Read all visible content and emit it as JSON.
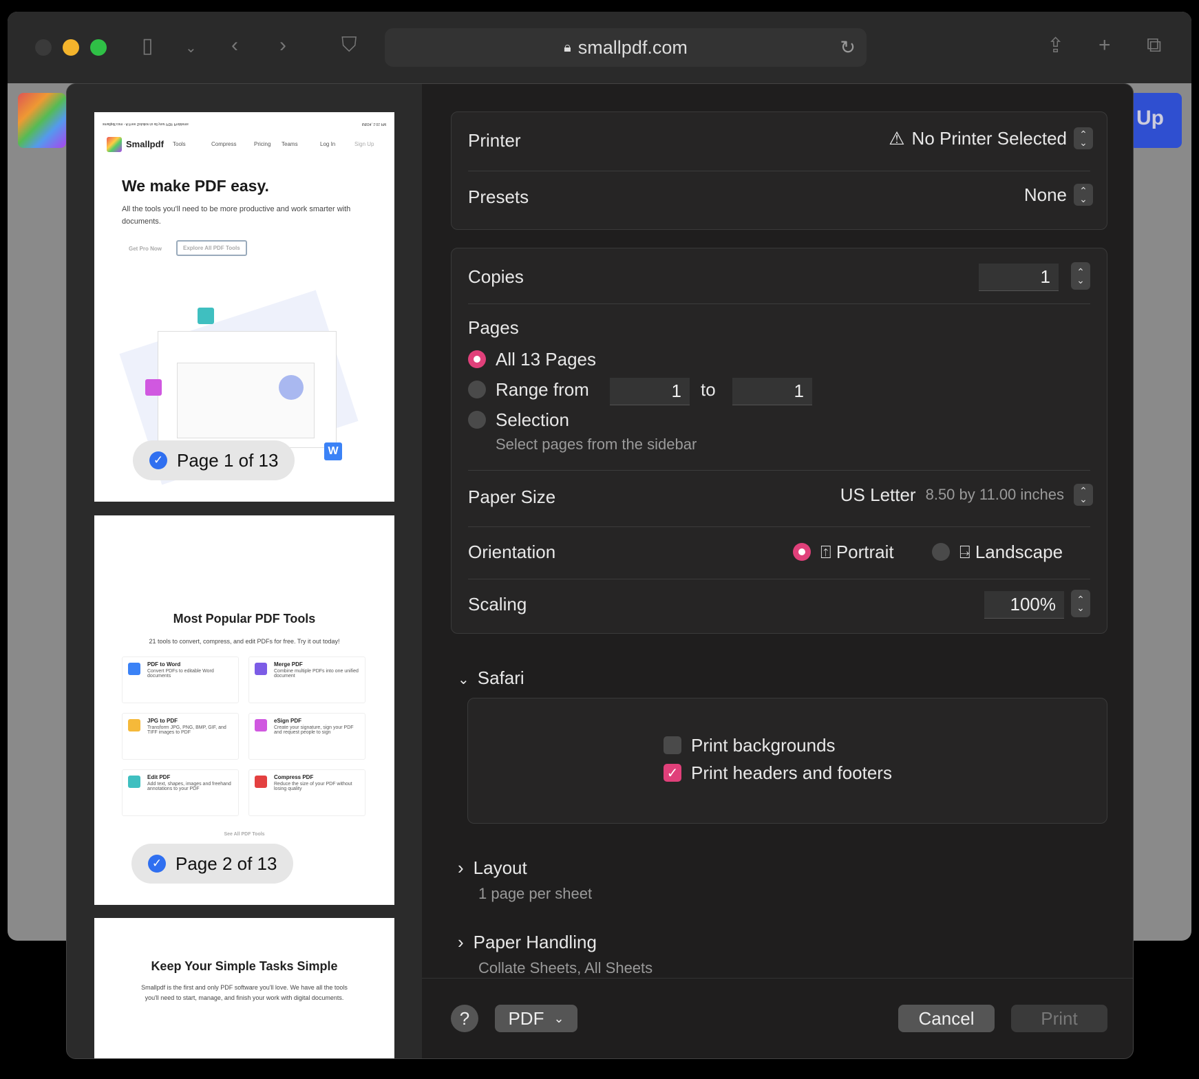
{
  "browser": {
    "url": "smallpdf.com",
    "partial_button": "Up"
  },
  "sidebar": {
    "pages": [
      {
        "badge": "Page 1 of 13",
        "header_left": "smallpdf.com - A Free Solution to all your PDF Problems",
        "header_right": "6/8/24, 1:01 PM",
        "nav": {
          "brand": "Smallpdf",
          "items": [
            "Tools",
            "Compress",
            "Pricing",
            "Teams",
            "Log In",
            "Sign Up"
          ]
        },
        "title": "We make PDF easy.",
        "subtitle": "All the tools you'll need to be more productive and work smarter with documents.",
        "buttons": [
          "Get Pro Now",
          "Explore All PDF Tools"
        ]
      },
      {
        "badge": "Page 2 of 13",
        "title": "Most Popular PDF Tools",
        "subtitle": "21 tools to convert, compress, and edit PDFs for free. Try it out today!",
        "tools": [
          {
            "name": "PDF to Word",
            "desc": "Convert PDFs to editable Word documents",
            "color": "#3b82f6"
          },
          {
            "name": "Merge PDF",
            "desc": "Combine multiple PDFs into one unified document",
            "color": "#7c5ce6"
          },
          {
            "name": "JPG to PDF",
            "desc": "Transform JPG, PNG, BMP, GIF, and TIFF images to PDF",
            "color": "#f5b93a"
          },
          {
            "name": "eSign PDF",
            "desc": "Create your signature, sign your PDF and request people to sign",
            "color": "#d058e0"
          },
          {
            "name": "Edit PDF",
            "desc": "Add text, shapes, images and freehand annotations to your PDF",
            "color": "#3fbfc0"
          },
          {
            "name": "Compress PDF",
            "desc": "Reduce the size of your PDF without losing quality",
            "color": "#e34040"
          }
        ],
        "link": "See All PDF Tools"
      },
      {
        "title": "Keep Your Simple Tasks Simple",
        "subtitle": "Smallpdf is the first and only PDF software you'll love. We have all the tools you'll need to start, manage, and finish your work with digital documents."
      }
    ]
  },
  "settings": {
    "printer": {
      "label": "Printer",
      "value": "No Printer Selected",
      "icon": "warning-icon"
    },
    "presets": {
      "label": "Presets",
      "value": "None"
    },
    "copies": {
      "label": "Copies",
      "value": "1"
    },
    "pages": {
      "label": "Pages",
      "all": "All 13 Pages",
      "range": "Range from",
      "range_from": "1",
      "to": "to",
      "range_to": "1",
      "selection": "Selection",
      "selection_hint": "Select pages from the sidebar",
      "selected": "all"
    },
    "paper_size": {
      "label": "Paper Size",
      "value": "US Letter",
      "detail": "8.50 by 11.00 inches"
    },
    "orientation": {
      "label": "Orientation",
      "portrait": "Portrait",
      "landscape": "Landscape",
      "selected": "portrait"
    },
    "scaling": {
      "label": "Scaling",
      "value": "100%"
    },
    "safari": {
      "label": "Safari",
      "print_backgrounds": "Print backgrounds",
      "print_backgrounds_checked": false,
      "headers_footers": "Print headers and footers",
      "headers_footers_checked": true
    },
    "layout": {
      "label": "Layout",
      "summary": "1 page per sheet"
    },
    "paper_handling": {
      "label": "Paper Handling",
      "summary": "Collate Sheets, All Sheets"
    }
  },
  "footer": {
    "help": "?",
    "pdf": "PDF",
    "cancel": "Cancel",
    "print": "Print"
  },
  "colors": {
    "accent": "#e0407a",
    "check_blue": "#2f6ff0"
  }
}
